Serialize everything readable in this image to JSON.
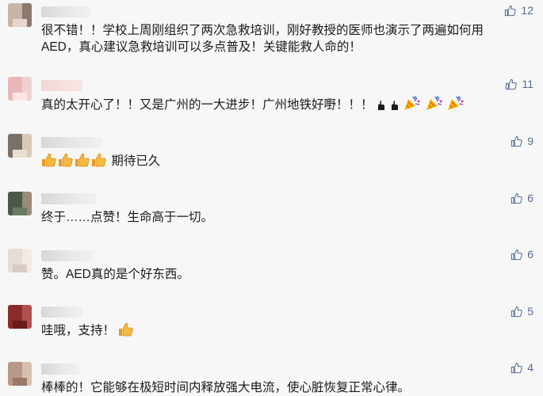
{
  "comments": [
    {
      "text_line1": "很不错！！学校上周刚组织了两次急救培训，刚好教授的医师也演示了两遍如何用",
      "text_line2": "AED，真心建议急救培训可以多点普及！关键能救人命的！",
      "likes": "12",
      "avatar_colors": [
        "#c7b5a8",
        "#8a7a70",
        "#e6d7cc"
      ]
    },
    {
      "text": "真的太开心了！！又是广州的一大进步！广州地铁好嘢！！！",
      "likes": "11",
      "avatar_colors": [
        "#e8b8b8",
        "#f0d0d0",
        "#ffe6e6"
      ],
      "emoji_after": [
        "point-icon",
        "point-icon",
        "party-popper-icon",
        "party-popper-icon",
        "party-popper-icon"
      ]
    },
    {
      "text": "期待已久",
      "likes": "9",
      "avatar_colors": [
        "#7a7068",
        "#d9c9b8",
        "#e8ded2"
      ],
      "emoji_before": [
        "thumbs-up-icon",
        "thumbs-up-icon",
        "thumbs-up-icon",
        "thumbs-up-icon"
      ]
    },
    {
      "text": "终于……点赞！生命高于一切。",
      "likes": "6",
      "avatar_colors": [
        "#4a5a48",
        "#9a8a7a",
        "#6a7a60"
      ]
    },
    {
      "text": "赞。AED真的是个好东西。",
      "likes": "6",
      "avatar_colors": [
        "#e6dcd8",
        "#f3eae6",
        "#d8ccc6"
      ]
    },
    {
      "text": "哇哦，支持！",
      "likes": "5",
      "avatar_colors": [
        "#8a2a2a",
        "#b05050",
        "#6a1a1a"
      ],
      "emoji_after": [
        "thumbs-up-icon"
      ]
    },
    {
      "text": "棒棒的！它能够在极短时间内释放强大电流，使心脏恢复正常心律。",
      "likes": "4",
      "avatar_colors": [
        "#b89888",
        "#d8c0b0",
        "#9a7868"
      ]
    }
  ],
  "colors": {
    "like": "#576b95",
    "thumb": "#f5a623",
    "background": "#f7f7f7"
  }
}
